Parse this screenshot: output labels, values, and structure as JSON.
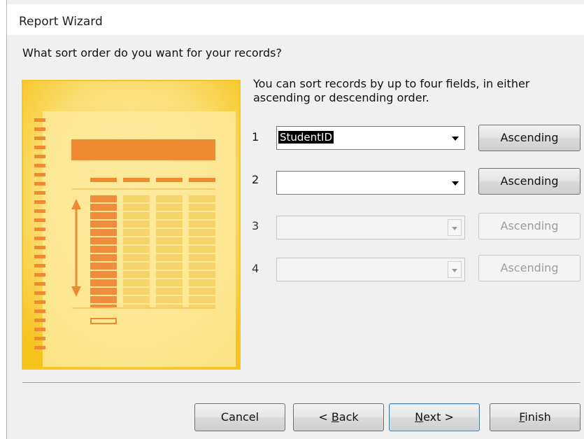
{
  "dialog": {
    "title": "Report Wizard",
    "question": "What sort order do you want for your records?",
    "description": "You can sort records by up to four fields, in either ascending or descending order."
  },
  "sort_rows": [
    {
      "number": "1",
      "field_value": "StudentID",
      "order": "Ascending",
      "enabled": true
    },
    {
      "number": "2",
      "field_value": "",
      "order": "Ascending",
      "enabled": true
    },
    {
      "number": "3",
      "field_value": "",
      "order": "Ascending",
      "enabled": false
    },
    {
      "number": "4",
      "field_value": "",
      "order": "Ascending",
      "enabled": false
    }
  ],
  "buttons": {
    "cancel": "Cancel",
    "back_prefix": "< ",
    "back_mnemonic": "B",
    "back_rest": "ack",
    "next_mnemonic": "N",
    "next_rest": "ext >",
    "finish_mnemonic": "F",
    "finish_rest": "inish"
  },
  "colors": {
    "illustration_bg": "#f6c21c",
    "illustration_light": "#fdeb9a",
    "orange": "#ef8a32"
  }
}
